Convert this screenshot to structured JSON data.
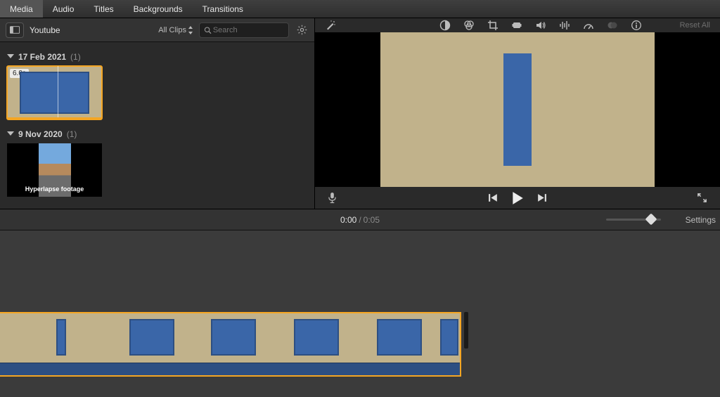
{
  "tabs": {
    "media": "Media",
    "audio": "Audio",
    "titles": "Titles",
    "backgrounds": "Backgrounds",
    "transitions": "Transitions"
  },
  "library": {
    "name": "Youtube",
    "filter_label": "All Clips",
    "search_placeholder": "Search",
    "events": [
      {
        "date": "17 Feb 2021",
        "count": "(1)",
        "clips": [
          {
            "duration": "6.0s",
            "selected": true
          }
        ]
      },
      {
        "date": "9 Nov 2020",
        "count": "(1)",
        "clips": [
          {
            "caption": "Hyperlapse footage"
          }
        ]
      }
    ]
  },
  "adjust": {
    "reset": "Reset All"
  },
  "timecode": {
    "current": "0:00",
    "total": "0:05"
  },
  "settings_label": "Settings",
  "icons": {
    "sidebar": "sidebar",
    "updown": "updown",
    "search": "search",
    "gear": "gear",
    "wand": "wand",
    "contrast": "contrast",
    "palette": "palette",
    "crop": "crop",
    "camera": "camera",
    "volume": "volume",
    "eq": "eq",
    "speed": "speed",
    "filters": "filters",
    "info": "info",
    "mic": "mic",
    "prev": "prev",
    "play": "play",
    "next": "next",
    "fullscreen": "fullscreen"
  }
}
